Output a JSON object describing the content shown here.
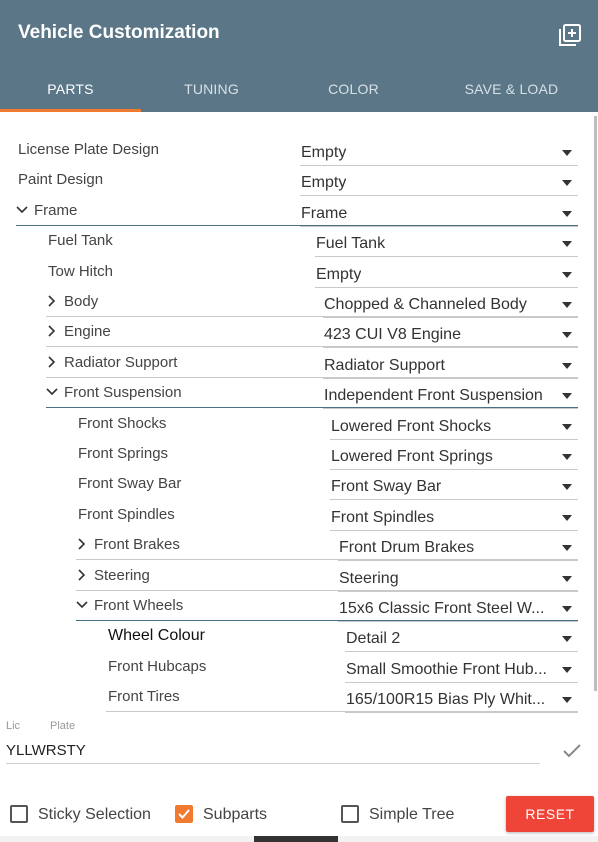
{
  "header": {
    "title": "Vehicle Customization",
    "bg_color": "#5b7787",
    "add_icon": "add-box-icon"
  },
  "tabs": [
    {
      "label": "PARTS",
      "active": true
    },
    {
      "label": "TUNING",
      "active": false
    },
    {
      "label": "COLOR",
      "active": false
    },
    {
      "label": "SAVE & LOAD",
      "active": false
    }
  ],
  "accent_color": "#f07a30",
  "tree": {
    "rows": [
      {
        "label": "License Plate Design",
        "value": "Empty",
        "depth": 0,
        "expander": "none"
      },
      {
        "label": "Paint Design",
        "value": "Empty",
        "depth": 0,
        "expander": "none"
      },
      {
        "label": "Frame",
        "value": "Frame",
        "depth": 0,
        "expander": "expanded"
      },
      {
        "label": "Fuel Tank",
        "value": "Fuel Tank",
        "depth": 1,
        "expander": "none"
      },
      {
        "label": "Tow Hitch",
        "value": "Empty",
        "depth": 1,
        "expander": "none"
      },
      {
        "label": "Body",
        "value": "Chopped & Channeled Body",
        "depth": 1,
        "expander": "collapsed"
      },
      {
        "label": "Engine",
        "value": "423 CUI V8 Engine",
        "depth": 1,
        "expander": "collapsed"
      },
      {
        "label": "Radiator Support",
        "value": "Radiator Support",
        "depth": 1,
        "expander": "collapsed"
      },
      {
        "label": "Front Suspension",
        "value": "Independent Front Suspension",
        "depth": 1,
        "expander": "expanded"
      },
      {
        "label": "Front Shocks",
        "value": "Lowered Front Shocks",
        "depth": 2,
        "expander": "none"
      },
      {
        "label": "Front Springs",
        "value": "Lowered Front Springs",
        "depth": 2,
        "expander": "none"
      },
      {
        "label": "Front Sway Bar",
        "value": "Front Sway Bar",
        "depth": 2,
        "expander": "none"
      },
      {
        "label": "Front Spindles",
        "value": "Front Spindles",
        "depth": 2,
        "expander": "none"
      },
      {
        "label": "Front Brakes",
        "value": "Front Drum Brakes",
        "depth": 2,
        "expander": "collapsed"
      },
      {
        "label": "Steering",
        "value": "Steering",
        "depth": 2,
        "expander": "collapsed"
      },
      {
        "label": "Front Wheels",
        "value": "15x6 Classic Front Steel W...",
        "depth": 2,
        "expander": "expanded"
      },
      {
        "label": "Wheel Colour",
        "value": "Detail 2",
        "depth": 3,
        "expander": "none"
      },
      {
        "label": "Front Hubcaps",
        "value": "Small Smoothie Front Hub...",
        "depth": 3,
        "expander": "none"
      },
      {
        "label": "Front Tires",
        "value": "165/100R15 Bias Ply Whit...",
        "depth": 3,
        "expander": "none"
      }
    ]
  },
  "plate": {
    "label_prefix": "Lic",
    "label": "Plate",
    "value": "YLLWRSTY",
    "confirm_icon": "check-icon"
  },
  "footer": {
    "sticky_selection": {
      "label": "Sticky Selection",
      "checked": false
    },
    "subparts": {
      "label": "Subparts",
      "checked": true
    },
    "simple_tree": {
      "label": "Simple Tree",
      "checked": false
    },
    "reset_label": "RESET",
    "reset_color": "#ef4438"
  }
}
